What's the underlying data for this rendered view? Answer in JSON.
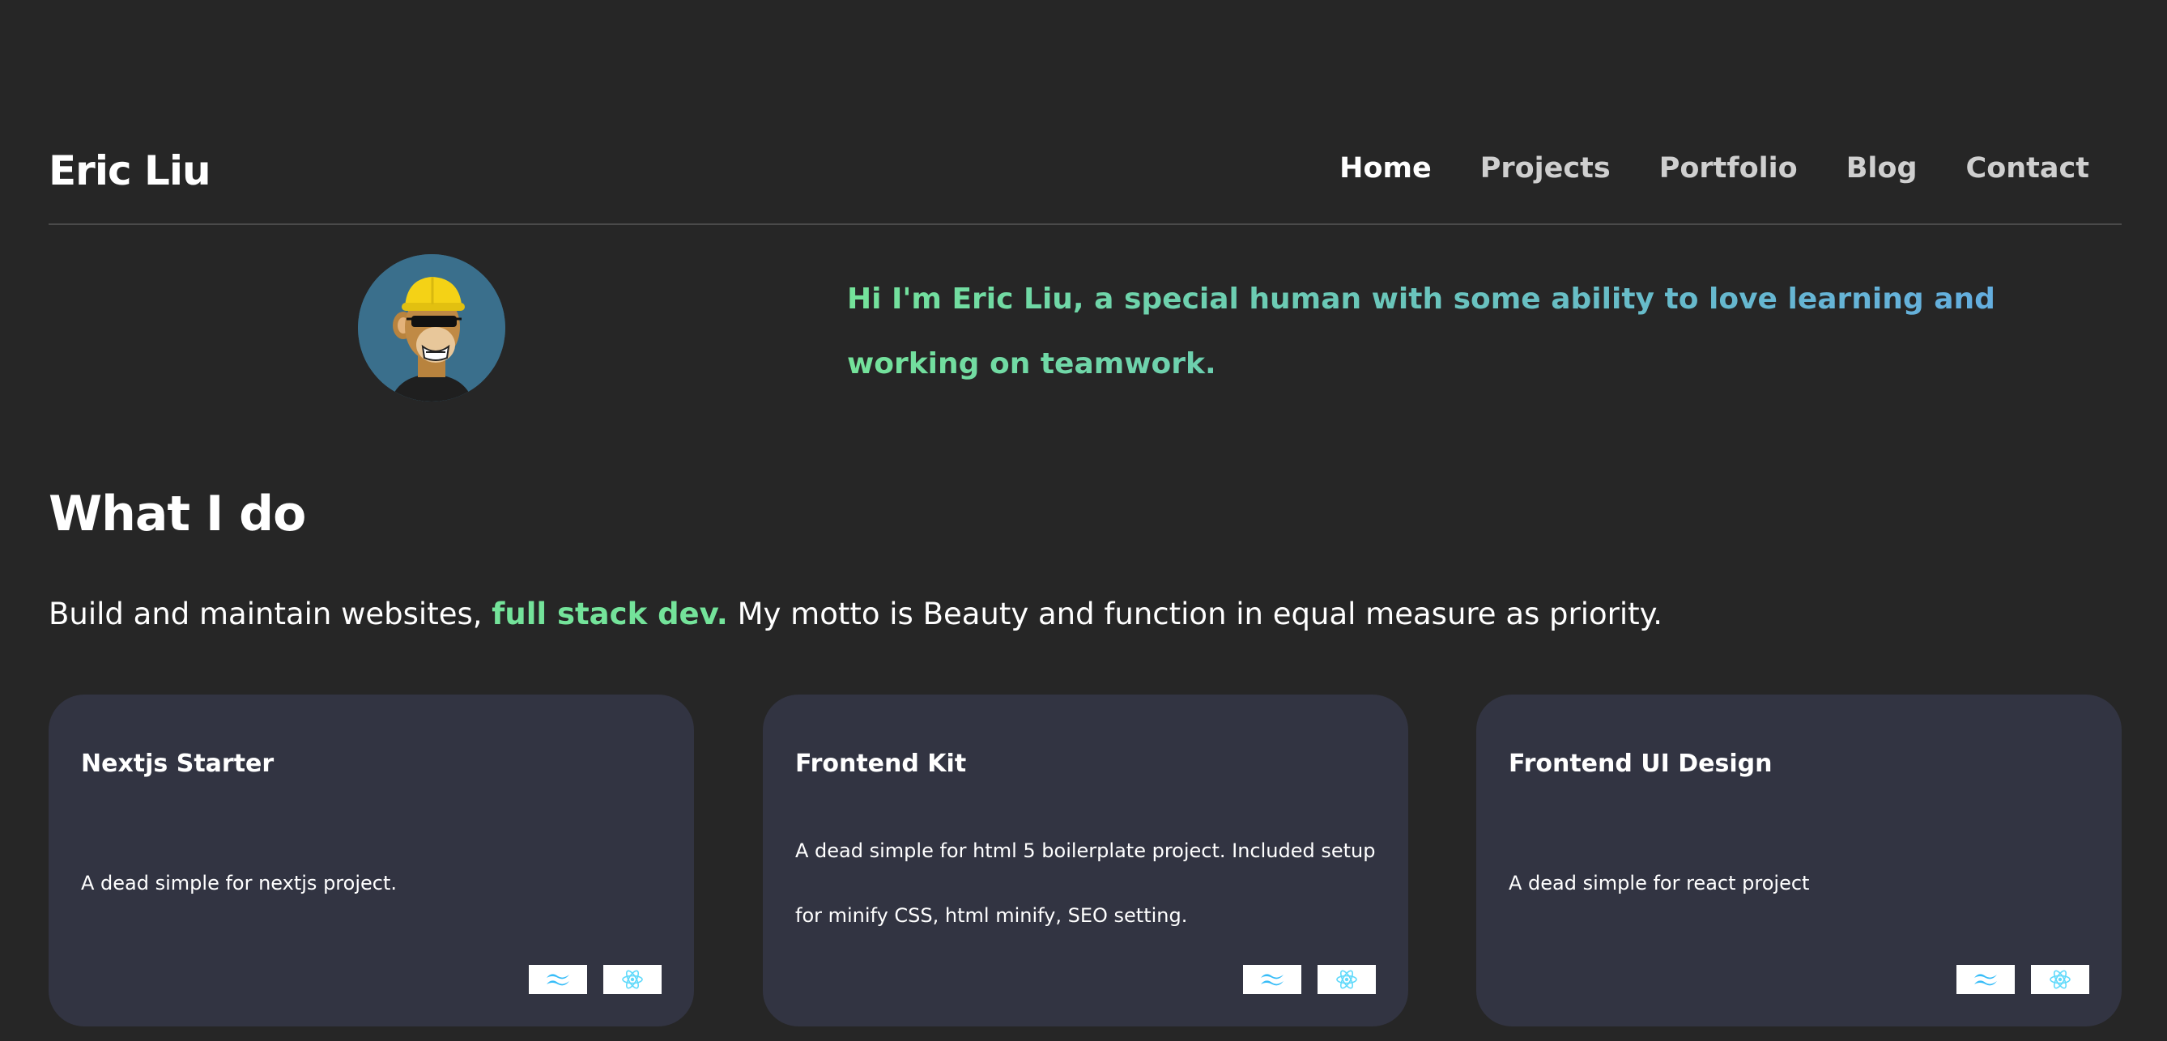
{
  "header": {
    "brand": "Eric Liu",
    "nav": [
      {
        "label": "Home",
        "active": true
      },
      {
        "label": "Projects",
        "active": false
      },
      {
        "label": "Portfolio",
        "active": false
      },
      {
        "label": "Blog",
        "active": false
      },
      {
        "label": "Contact",
        "active": false
      }
    ]
  },
  "hero": {
    "avatar_icon": "ape-avatar-icon",
    "text": "Hi I'm Eric Liu, a special human with some ability to love learning and working on teamwork."
  },
  "what_i_do": {
    "title": "What I do",
    "intro_before": "Build and maintain websites,",
    "intro_highlight": "full stack dev.",
    "intro_after": "My motto is Beauty and function in equal measure as priority."
  },
  "cards": [
    {
      "title": "Nextjs Starter",
      "description": "A dead simple for nextjs project.",
      "badges": [
        "tailwind-icon",
        "react-icon"
      ]
    },
    {
      "title": "Frontend Kit",
      "description": "A dead simple for html 5 boilerplate project. Included setup for minify CSS, html minify, SEO setting.",
      "badges": [
        "tailwind-icon",
        "react-icon"
      ]
    },
    {
      "title": "Frontend UI Design",
      "description": "A dead simple for react project",
      "badges": [
        "tailwind-icon",
        "react-icon"
      ]
    }
  ],
  "colors": {
    "background": "#262626",
    "card": "#323442",
    "accent_green": "#74e39a",
    "accent_blue": "#63a9e6",
    "tailwind": "#38bdf8",
    "react": "#61dafb"
  }
}
